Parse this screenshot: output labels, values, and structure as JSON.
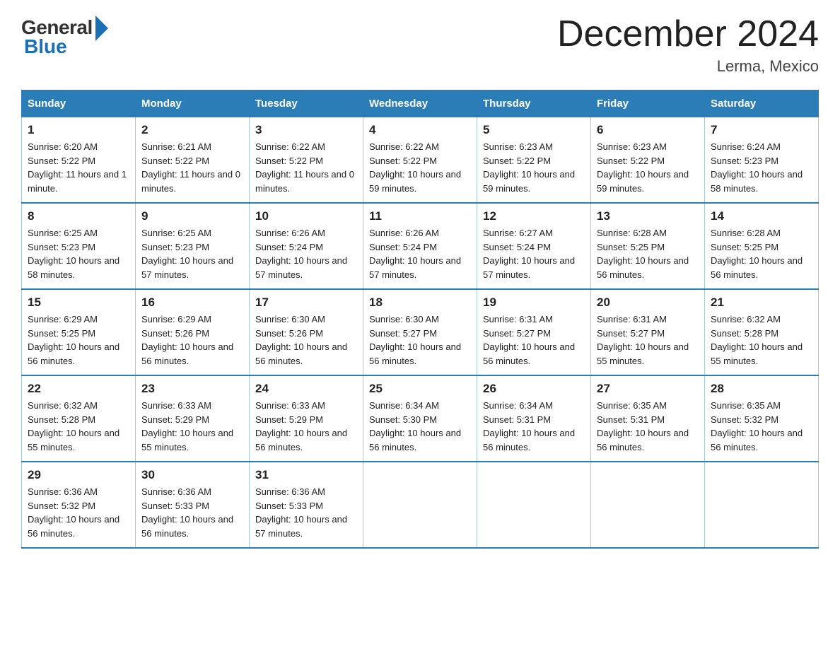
{
  "header": {
    "logo_general": "General",
    "logo_blue": "Blue",
    "month_title": "December 2024",
    "location": "Lerma, Mexico"
  },
  "days_of_week": [
    "Sunday",
    "Monday",
    "Tuesday",
    "Wednesday",
    "Thursday",
    "Friday",
    "Saturday"
  ],
  "weeks": [
    [
      {
        "num": "1",
        "sunrise": "Sunrise: 6:20 AM",
        "sunset": "Sunset: 5:22 PM",
        "daylight": "Daylight: 11 hours and 1 minute."
      },
      {
        "num": "2",
        "sunrise": "Sunrise: 6:21 AM",
        "sunset": "Sunset: 5:22 PM",
        "daylight": "Daylight: 11 hours and 0 minutes."
      },
      {
        "num": "3",
        "sunrise": "Sunrise: 6:22 AM",
        "sunset": "Sunset: 5:22 PM",
        "daylight": "Daylight: 11 hours and 0 minutes."
      },
      {
        "num": "4",
        "sunrise": "Sunrise: 6:22 AM",
        "sunset": "Sunset: 5:22 PM",
        "daylight": "Daylight: 10 hours and 59 minutes."
      },
      {
        "num": "5",
        "sunrise": "Sunrise: 6:23 AM",
        "sunset": "Sunset: 5:22 PM",
        "daylight": "Daylight: 10 hours and 59 minutes."
      },
      {
        "num": "6",
        "sunrise": "Sunrise: 6:23 AM",
        "sunset": "Sunset: 5:22 PM",
        "daylight": "Daylight: 10 hours and 59 minutes."
      },
      {
        "num": "7",
        "sunrise": "Sunrise: 6:24 AM",
        "sunset": "Sunset: 5:23 PM",
        "daylight": "Daylight: 10 hours and 58 minutes."
      }
    ],
    [
      {
        "num": "8",
        "sunrise": "Sunrise: 6:25 AM",
        "sunset": "Sunset: 5:23 PM",
        "daylight": "Daylight: 10 hours and 58 minutes."
      },
      {
        "num": "9",
        "sunrise": "Sunrise: 6:25 AM",
        "sunset": "Sunset: 5:23 PM",
        "daylight": "Daylight: 10 hours and 57 minutes."
      },
      {
        "num": "10",
        "sunrise": "Sunrise: 6:26 AM",
        "sunset": "Sunset: 5:24 PM",
        "daylight": "Daylight: 10 hours and 57 minutes."
      },
      {
        "num": "11",
        "sunrise": "Sunrise: 6:26 AM",
        "sunset": "Sunset: 5:24 PM",
        "daylight": "Daylight: 10 hours and 57 minutes."
      },
      {
        "num": "12",
        "sunrise": "Sunrise: 6:27 AM",
        "sunset": "Sunset: 5:24 PM",
        "daylight": "Daylight: 10 hours and 57 minutes."
      },
      {
        "num": "13",
        "sunrise": "Sunrise: 6:28 AM",
        "sunset": "Sunset: 5:25 PM",
        "daylight": "Daylight: 10 hours and 56 minutes."
      },
      {
        "num": "14",
        "sunrise": "Sunrise: 6:28 AM",
        "sunset": "Sunset: 5:25 PM",
        "daylight": "Daylight: 10 hours and 56 minutes."
      }
    ],
    [
      {
        "num": "15",
        "sunrise": "Sunrise: 6:29 AM",
        "sunset": "Sunset: 5:25 PM",
        "daylight": "Daylight: 10 hours and 56 minutes."
      },
      {
        "num": "16",
        "sunrise": "Sunrise: 6:29 AM",
        "sunset": "Sunset: 5:26 PM",
        "daylight": "Daylight: 10 hours and 56 minutes."
      },
      {
        "num": "17",
        "sunrise": "Sunrise: 6:30 AM",
        "sunset": "Sunset: 5:26 PM",
        "daylight": "Daylight: 10 hours and 56 minutes."
      },
      {
        "num": "18",
        "sunrise": "Sunrise: 6:30 AM",
        "sunset": "Sunset: 5:27 PM",
        "daylight": "Daylight: 10 hours and 56 minutes."
      },
      {
        "num": "19",
        "sunrise": "Sunrise: 6:31 AM",
        "sunset": "Sunset: 5:27 PM",
        "daylight": "Daylight: 10 hours and 56 minutes."
      },
      {
        "num": "20",
        "sunrise": "Sunrise: 6:31 AM",
        "sunset": "Sunset: 5:27 PM",
        "daylight": "Daylight: 10 hours and 55 minutes."
      },
      {
        "num": "21",
        "sunrise": "Sunrise: 6:32 AM",
        "sunset": "Sunset: 5:28 PM",
        "daylight": "Daylight: 10 hours and 55 minutes."
      }
    ],
    [
      {
        "num": "22",
        "sunrise": "Sunrise: 6:32 AM",
        "sunset": "Sunset: 5:28 PM",
        "daylight": "Daylight: 10 hours and 55 minutes."
      },
      {
        "num": "23",
        "sunrise": "Sunrise: 6:33 AM",
        "sunset": "Sunset: 5:29 PM",
        "daylight": "Daylight: 10 hours and 55 minutes."
      },
      {
        "num": "24",
        "sunrise": "Sunrise: 6:33 AM",
        "sunset": "Sunset: 5:29 PM",
        "daylight": "Daylight: 10 hours and 56 minutes."
      },
      {
        "num": "25",
        "sunrise": "Sunrise: 6:34 AM",
        "sunset": "Sunset: 5:30 PM",
        "daylight": "Daylight: 10 hours and 56 minutes."
      },
      {
        "num": "26",
        "sunrise": "Sunrise: 6:34 AM",
        "sunset": "Sunset: 5:31 PM",
        "daylight": "Daylight: 10 hours and 56 minutes."
      },
      {
        "num": "27",
        "sunrise": "Sunrise: 6:35 AM",
        "sunset": "Sunset: 5:31 PM",
        "daylight": "Daylight: 10 hours and 56 minutes."
      },
      {
        "num": "28",
        "sunrise": "Sunrise: 6:35 AM",
        "sunset": "Sunset: 5:32 PM",
        "daylight": "Daylight: 10 hours and 56 minutes."
      }
    ],
    [
      {
        "num": "29",
        "sunrise": "Sunrise: 6:36 AM",
        "sunset": "Sunset: 5:32 PM",
        "daylight": "Daylight: 10 hours and 56 minutes."
      },
      {
        "num": "30",
        "sunrise": "Sunrise: 6:36 AM",
        "sunset": "Sunset: 5:33 PM",
        "daylight": "Daylight: 10 hours and 56 minutes."
      },
      {
        "num": "31",
        "sunrise": "Sunrise: 6:36 AM",
        "sunset": "Sunset: 5:33 PM",
        "daylight": "Daylight: 10 hours and 57 minutes."
      },
      null,
      null,
      null,
      null
    ]
  ]
}
